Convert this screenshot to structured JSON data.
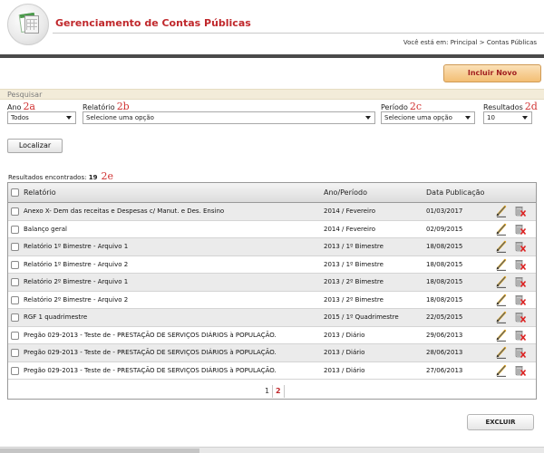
{
  "header": {
    "app_title": "Gerenciamento de Contas Públicas",
    "breadcrumb": "Você está em: Principal > Contas Públicas"
  },
  "toolbar": {
    "add_label": "Incluir Novo"
  },
  "search": {
    "section_label": "Pesquisar",
    "fields": [
      {
        "label": "Ano",
        "tag": "2a",
        "value": "Todos"
      },
      {
        "label": "Relatório",
        "tag": "2b",
        "value": "Selecione uma opção"
      },
      {
        "label": "Período",
        "tag": "2c",
        "value": "Selecione uma opção"
      },
      {
        "label": "Resultados",
        "tag": "2d",
        "value": "10"
      }
    ],
    "submit_label": "Localizar"
  },
  "results": {
    "label": "Resultados encontrados:",
    "count": "19",
    "tag": "2e"
  },
  "table": {
    "columns": [
      "Relatório",
      "Ano/Período",
      "Data Publicação"
    ],
    "rows": [
      {
        "report": "Anexo X- Dem das receitas e Despesas c/ Manut. e Des. Ensino",
        "period": "2014 / Fevereiro",
        "date": "01/03/2017"
      },
      {
        "report": "Balanço geral",
        "period": "2014 / Fevereiro",
        "date": "02/09/2015"
      },
      {
        "report": "Relatório 1º Bimestre - Arquivo 1",
        "period": "2013 / 1º Bimestre",
        "date": "18/08/2015"
      },
      {
        "report": "Relatório 1º Bimestre - Arquivo 2",
        "period": "2013 / 1º Bimestre",
        "date": "18/08/2015"
      },
      {
        "report": "Relatório 2º Bimestre - Arquivo 1",
        "period": "2013 / 2º Bimestre",
        "date": "18/08/2015"
      },
      {
        "report": "Relatório 2º Bimestre - Arquivo 2",
        "period": "2013 / 2º Bimestre",
        "date": "18/08/2015"
      },
      {
        "report": "RGF 1 quadrimestre",
        "period": "2015 / 1º Quadrimestre",
        "date": "22/05/2015"
      },
      {
        "report": "Pregão 029-2013 - Teste de - PRESTAÇÃO DE SERVIÇOS DIÁRIOS à POPULAÇÃO.",
        "period": "2013 / Diário",
        "date": "29/06/2013"
      },
      {
        "report": "Pregão 029-2013 - Teste de - PRESTAÇÃO DE SERVIÇOS DIÁRIOS à POPULAÇÃO.",
        "period": "2013 / Diário",
        "date": "28/06/2013"
      },
      {
        "report": "Pregão 029-2013 - Teste de - PRESTAÇÃO DE SERVIÇOS DIÁRIOS à POPULAÇÃO.",
        "period": "2013 / Diário",
        "date": "27/06/2013"
      }
    ],
    "row_actions": [
      "edit-icon",
      "delete-icon"
    ]
  },
  "pagination": {
    "pages": [
      "1",
      "2"
    ],
    "current": "2"
  },
  "footer": {
    "delete_label": "EXCLUIR"
  },
  "colors": {
    "brand_red": "#c0282c",
    "accent_orange": "#f3be74",
    "search_band": "#f3ecd9",
    "annotation_red": "#d03030"
  }
}
